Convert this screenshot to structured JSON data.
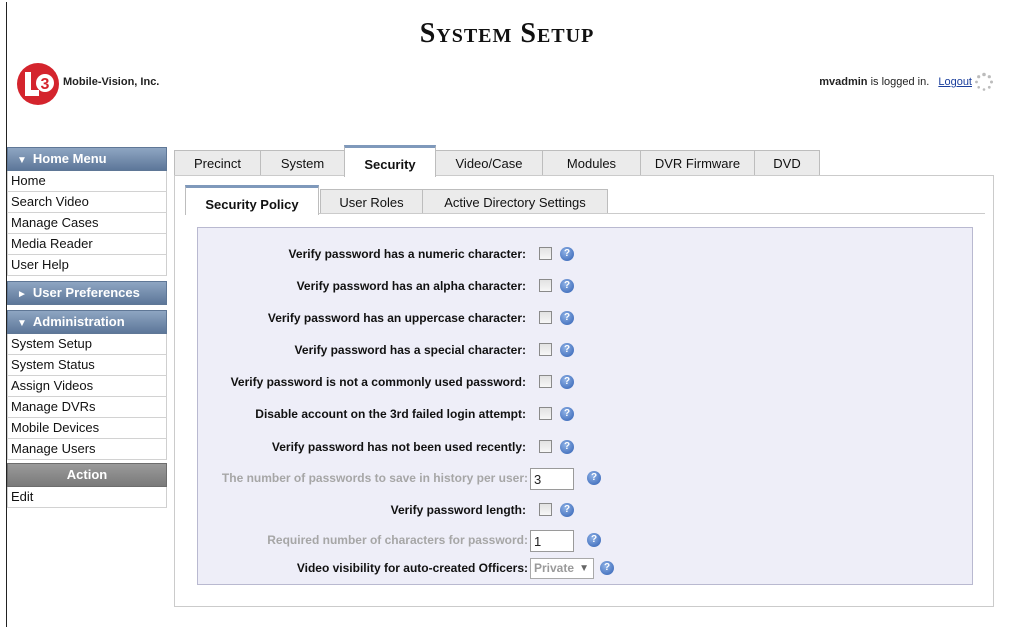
{
  "header": {
    "title": "System Setup",
    "company": "Mobile-Vision, Inc.",
    "logo_text": "3",
    "username": "mvadmin",
    "logged_in_text": "is logged in.",
    "logout_label": "Logout"
  },
  "sidebar": {
    "home_menu": {
      "title": "Home Menu",
      "items": [
        "Home",
        "Search Video",
        "Manage Cases",
        "Media Reader",
        "User Help"
      ]
    },
    "user_prefs": {
      "title": "User Preferences"
    },
    "administration": {
      "title": "Administration",
      "items": [
        "System Setup",
        "System Status",
        "Assign Videos",
        "Manage DVRs",
        "Mobile Devices",
        "Manage Users"
      ]
    },
    "action": {
      "title": "Action",
      "items": [
        "Edit"
      ]
    }
  },
  "tabs": [
    "Precinct",
    "System",
    "Security",
    "Video/Case",
    "Modules",
    "DVR Firmware",
    "DVD"
  ],
  "active_tab": "Security",
  "subtabs": [
    "Security Policy",
    "User Roles",
    "Active Directory Settings"
  ],
  "active_subtab": "Security Policy",
  "policy": {
    "numeric": "Verify password has a numeric character:",
    "alpha": "Verify password has an alpha character:",
    "uppercase": "Verify password has an uppercase character:",
    "special": "Verify password has a special character:",
    "common": "Verify password is not a commonly used password:",
    "disable": "Disable account on the 3rd failed login attempt:",
    "recent": "Verify password has not been used recently:",
    "history_label": "The number of passwords to save in history per user:",
    "history_value": "3",
    "length": "Verify password length:",
    "required_label": "Required number of characters for password:",
    "required_value": "1",
    "visibility_label": "Video visibility for auto-created Officers:",
    "visibility_value": "Private"
  },
  "icons": {
    "help": "help-icon",
    "spinner": "loading-spinner-icon",
    "dropdown": "chevron-down-icon"
  },
  "colors": {
    "accent": "#7f99bb",
    "panel": "#eeeef8",
    "link": "#1a3e9c"
  }
}
